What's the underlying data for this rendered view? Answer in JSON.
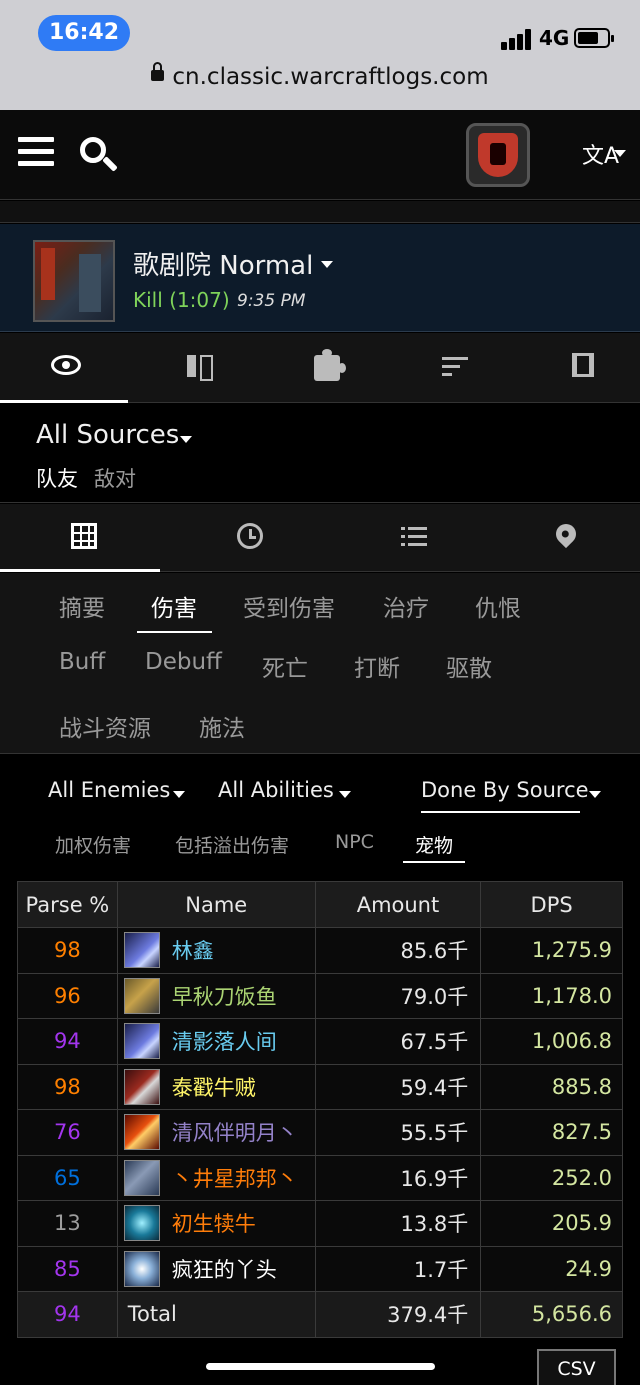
{
  "status_bar": {
    "time": "16:42",
    "network": "4G"
  },
  "browser": {
    "url": "cn.classic.warcraftlogs.com"
  },
  "fight": {
    "title": "歌剧院 Normal",
    "result": "Kill (1:07)",
    "time": "9:35 PM"
  },
  "sources": {
    "label": "All Sources",
    "friendly": "队友",
    "enemy": "敌对"
  },
  "categories": {
    "summary": "摘要",
    "damage": "伤害",
    "damage_taken": "受到伤害",
    "healing": "治疗",
    "threat": "仇恨",
    "buff": "Buff",
    "debuff": "Debuff",
    "deaths": "死亡",
    "interrupts": "打断",
    "dispels": "驱散",
    "resources": "战斗资源",
    "casts": "施法"
  },
  "filters": {
    "enemies": "All Enemies",
    "abilities": "All Abilities",
    "view": "Done By Source"
  },
  "subtabs": {
    "weighted": "加权伤害",
    "overkill": "包括溢出伤害",
    "npc": "NPC",
    "pets": "宠物"
  },
  "table": {
    "headers": {
      "parse": "Parse %",
      "name": "Name",
      "amount": "Amount",
      "dps": "DPS"
    },
    "rows": [
      {
        "parse": "98",
        "parse_color": "#ff8000",
        "name": "林鑫",
        "name_color": "#69ccf0",
        "icon": "mage-frost-icon",
        "amount": "85.6千",
        "dps": "1,275.9"
      },
      {
        "parse": "96",
        "parse_color": "#ff8000",
        "name": "早秋刀饭鱼",
        "name_color": "#abd473",
        "icon": "hunter-icon",
        "amount": "79.0千",
        "dps": "1,178.0"
      },
      {
        "parse": "94",
        "parse_color": "#a335ee",
        "name": "清影落人间",
        "name_color": "#69ccf0",
        "icon": "mage-frost-icon",
        "amount": "67.5千",
        "dps": "1,006.8"
      },
      {
        "parse": "98",
        "parse_color": "#ff8000",
        "name": "泰戳牛贼",
        "name_color": "#fff569",
        "icon": "rogue-icon",
        "amount": "59.4千",
        "dps": "885.8"
      },
      {
        "parse": "76",
        "parse_color": "#a335ee",
        "name": "清风伴明月丶",
        "name_color": "#9482c9",
        "icon": "warlock-destruction-icon",
        "amount": "55.5千",
        "dps": "827.5"
      },
      {
        "parse": "65",
        "parse_color": "#0070dd",
        "name": "丶井星邦邦丶",
        "name_color": "#ff7d0a",
        "icon": "druid-feral-icon",
        "amount": "16.9千",
        "dps": "252.0"
      },
      {
        "parse": "13",
        "parse_color": "#9d9d9d",
        "name": "初生犊牛",
        "name_color": "#ff7d0a",
        "icon": "druid-balance-icon",
        "amount": "13.8千",
        "dps": "205.9"
      },
      {
        "parse": "85",
        "parse_color": "#a335ee",
        "name": "疯狂的丫头",
        "name_color": "#ffffff",
        "icon": "priest-shadow-icon",
        "amount": "1.7千",
        "dps": "24.9"
      }
    ],
    "total": {
      "parse": "94",
      "parse_color": "#a335ee",
      "label": "Total",
      "amount": "379.4千",
      "dps": "5,656.6"
    }
  },
  "csv_label": "CSV"
}
